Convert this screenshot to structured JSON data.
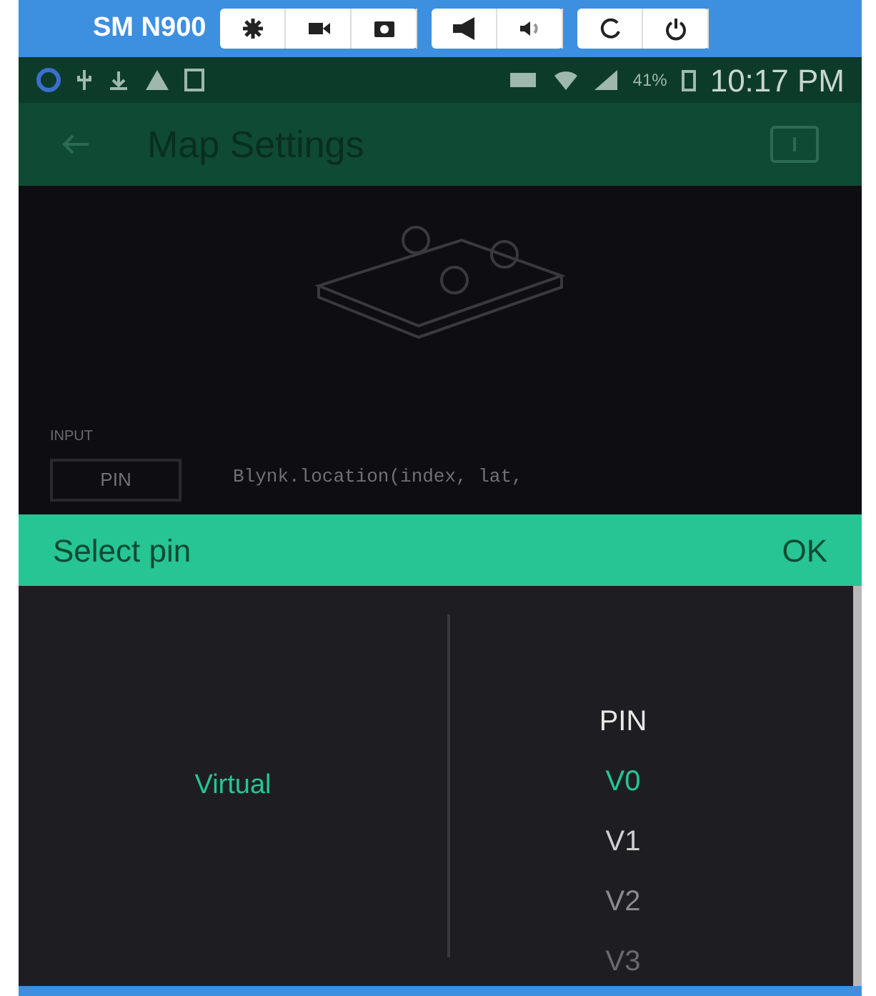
{
  "mirror_toolbar": {
    "device_name": "SM N900"
  },
  "status_bar": {
    "battery": "41%",
    "time": "10:17 PM"
  },
  "app_bar": {
    "title": "Map Settings"
  },
  "background": {
    "input_label": "INPUT",
    "pin_button": "PIN",
    "code": "Blynk.location(index, lat,"
  },
  "dialog": {
    "title": "Select pin",
    "ok": "OK",
    "types": [
      {
        "label": "Virtual",
        "selected": true
      }
    ],
    "pins": [
      {
        "label": "PIN",
        "selected": false
      },
      {
        "label": "V0",
        "selected": true
      },
      {
        "label": "V1",
        "selected": false
      },
      {
        "label": "V2",
        "selected": false
      },
      {
        "label": "V3",
        "selected": false
      }
    ]
  }
}
